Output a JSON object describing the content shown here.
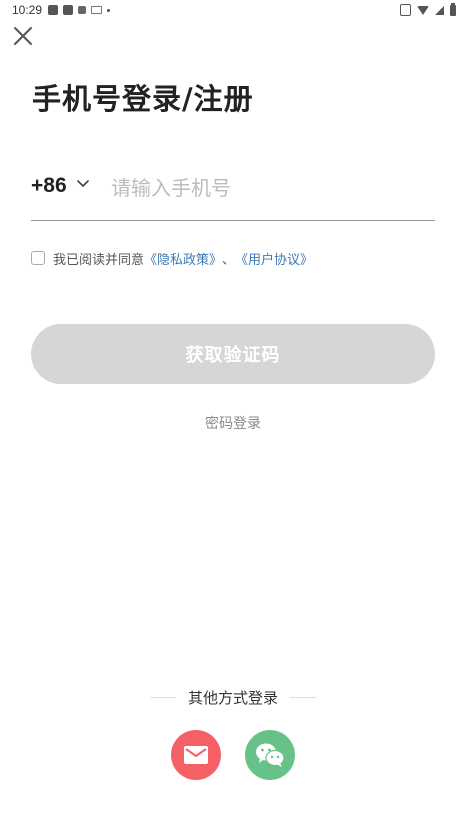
{
  "status_bar": {
    "time": "10:29"
  },
  "login": {
    "title": "手机号登录/注册",
    "country_code": "+86",
    "phone_placeholder": "请输入手机号",
    "agreement": {
      "prefix": "我已阅读并同意",
      "privacy_link": "《隐私政策》",
      "separator": "、",
      "terms_link": "《用户协议》"
    },
    "get_code_button": "获取验证码",
    "password_login_link": "密码登录"
  },
  "other_login": {
    "label": "其他方式登录",
    "methods": [
      {
        "icon": "mail-icon",
        "color": "#f46065"
      },
      {
        "icon": "wechat-icon",
        "color": "#67c28a"
      }
    ]
  },
  "colors": {
    "link": "#3b7ab8",
    "button_disabled": "#d6d6d6",
    "mail": "#f46065",
    "wechat": "#67c28a"
  }
}
